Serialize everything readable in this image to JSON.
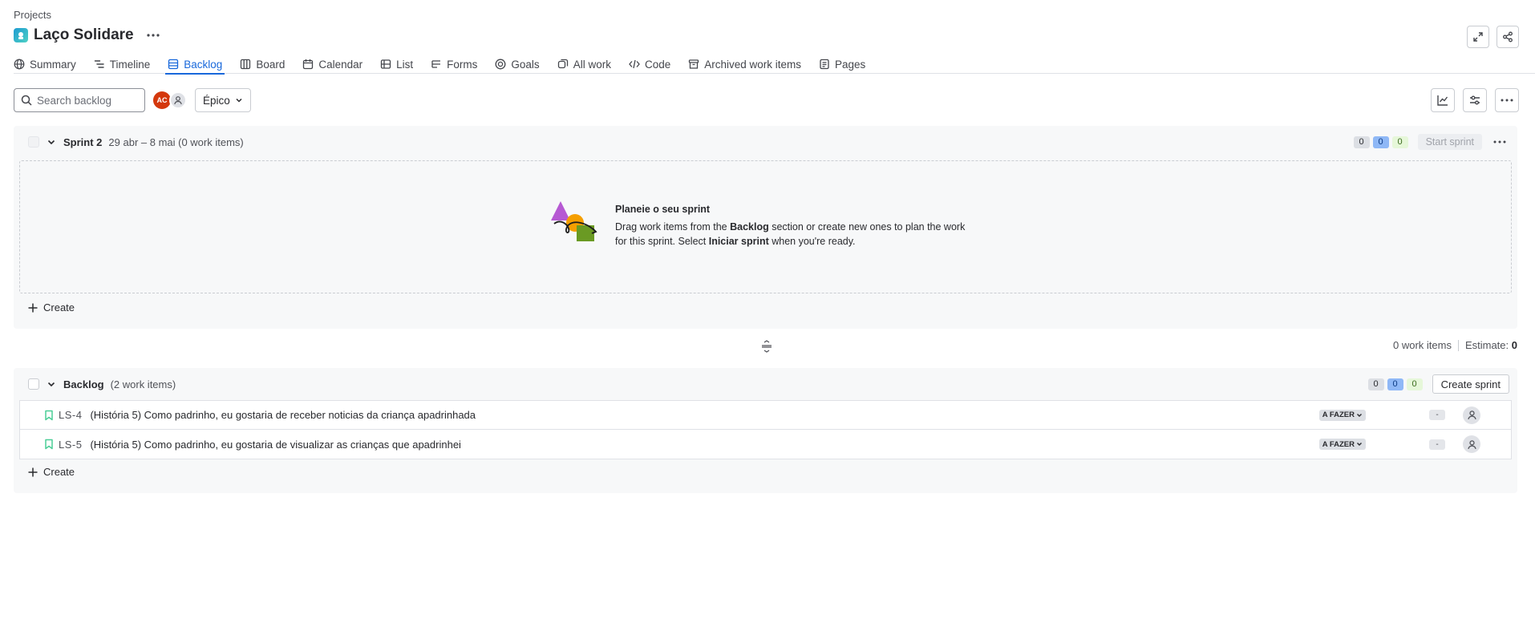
{
  "breadcrumb": "Projects",
  "project": {
    "title": "Laço Solidare"
  },
  "tabs": [
    {
      "label": "Summary",
      "icon": "globe-icon"
    },
    {
      "label": "Timeline",
      "icon": "timeline-icon"
    },
    {
      "label": "Backlog",
      "icon": "backlog-icon",
      "active": true
    },
    {
      "label": "Board",
      "icon": "board-icon"
    },
    {
      "label": "Calendar",
      "icon": "calendar-icon"
    },
    {
      "label": "List",
      "icon": "list-icon"
    },
    {
      "label": "Forms",
      "icon": "forms-icon"
    },
    {
      "label": "Goals",
      "icon": "goals-icon"
    },
    {
      "label": "All work",
      "icon": "all-work-icon"
    },
    {
      "label": "Code",
      "icon": "code-icon"
    },
    {
      "label": "Archived work items",
      "icon": "archive-icon"
    },
    {
      "label": "Pages",
      "icon": "pages-icon"
    }
  ],
  "toolbar": {
    "search_placeholder": "Search backlog",
    "avatar_initials": "AC",
    "epic_filter": "Épico"
  },
  "sprint": {
    "name": "Sprint 2",
    "meta": "29 abr – 8 mai (0 work items)",
    "counts": {
      "todo": "0",
      "in_progress": "0",
      "done": "0"
    },
    "start_label": "Start sprint",
    "empty_title": "Planeie o seu sprint",
    "empty_desc_1": "Drag work items from the ",
    "empty_desc_bold_1": "Backlog",
    "empty_desc_2": " section or create new ones to plan the work for this sprint. Select ",
    "empty_desc_bold_2": "Iniciar sprint",
    "empty_desc_3": " when you're ready.",
    "create_label": "Create"
  },
  "summary": {
    "work_items": "0 work items",
    "estimate_label": "Estimate:",
    "estimate_value": "0"
  },
  "backlog": {
    "name": "Backlog",
    "meta": "(2 work items)",
    "counts": {
      "todo": "0",
      "in_progress": "0",
      "done": "0"
    },
    "create_sprint_label": "Create sprint",
    "create_label": "Create",
    "items": [
      {
        "key": "LS-4",
        "summary": "(História 5) Como padrinho, eu gostaria de receber noticias da criança apadrinhada",
        "status": "A FAZER",
        "estimate": "-"
      },
      {
        "key": "LS-5",
        "summary": "(História 5) Como padrinho, eu gostaria de visualizar as crianças que apadrinhei",
        "status": "A FAZER",
        "estimate": "-"
      }
    ]
  },
  "colors": {
    "accent": "#1868db",
    "avatar": "#d4380d",
    "story": "#4bce97"
  }
}
